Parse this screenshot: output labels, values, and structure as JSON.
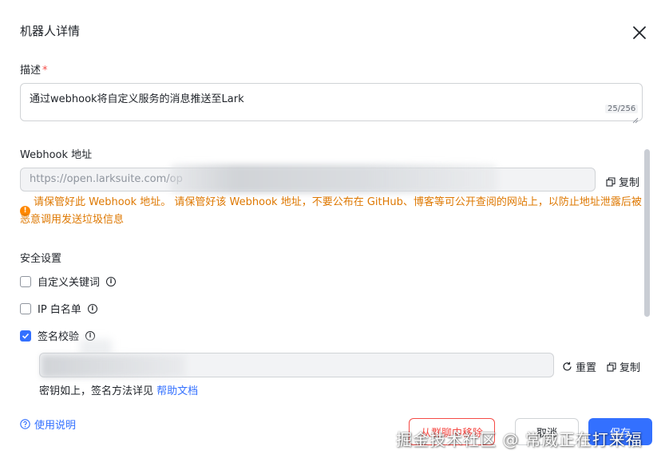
{
  "dialog": {
    "title": "机器人详情"
  },
  "description": {
    "label": "描述",
    "required_mark": "*",
    "value": "通过webhook将自定义服务的消息推送至Lark",
    "counter": "25/256"
  },
  "webhook": {
    "label": "Webhook 地址",
    "value": "https://open.larksuite.com/op",
    "copy_label": "复制",
    "warning": "请保管好此 Webhook 地址。 请保管好该 Webhook 地址，不要公布在 GitHub、博客等可公开查阅的网站上，以防止地址泄露后被恶意调用发送垃圾信息"
  },
  "security": {
    "label": "安全设置",
    "options": [
      {
        "label": "自定义关键词",
        "checked": false
      },
      {
        "label": "IP 白名单",
        "checked": false
      },
      {
        "label": "签名校验",
        "checked": true
      }
    ],
    "secret_reset_label": "重置",
    "secret_copy_label": "复制",
    "hint_text": "密钥如上，签名方法详见",
    "hint_link": "帮助文档"
  },
  "footer": {
    "help_label": "使用说明",
    "remove_label": "从群聊中移除",
    "cancel_label": "取消",
    "save_label": "保存"
  },
  "watermark": "掘金技术社区 @ 常威正在打来福",
  "colors": {
    "primary": "#3370ff",
    "danger": "#f54a45",
    "warning": "#de7802"
  }
}
